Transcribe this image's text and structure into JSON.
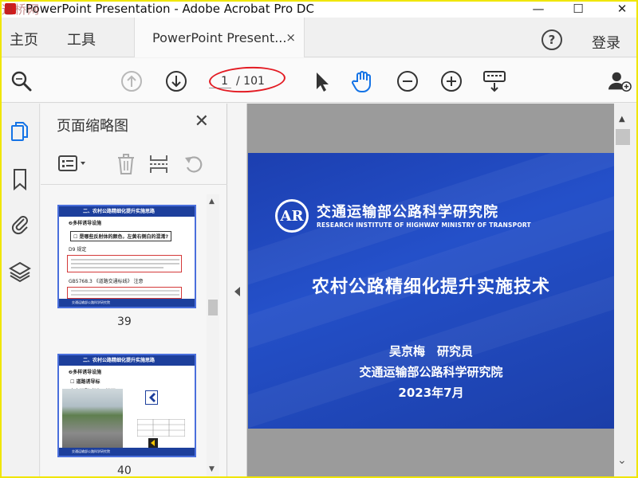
{
  "window": {
    "title": "PowerPoint Presentation - Adobe Acrobat Pro DC",
    "watermark": "道桥网",
    "controls": {
      "minimize": "—",
      "maximize": "☐",
      "close": "✕"
    }
  },
  "menubar": {
    "home_label": "主页",
    "tools_label": "工具",
    "tab_label": "PowerPoint Present...",
    "tab_close": "×",
    "help_glyph": "?",
    "login_label": "登录"
  },
  "toolbar": {
    "icons": [
      "search-icon",
      "prev-page-icon",
      "next-page-icon",
      "select-arrow-icon",
      "hand-tool-icon",
      "zoom-out-icon",
      "zoom-in-icon",
      "keyboard-icon",
      "add-user-icon"
    ],
    "current_page": "1",
    "total_pages": "/ 101",
    "highlight_color": "#e31b23"
  },
  "rail": {
    "icons": [
      "page-thumbnails-icon",
      "bookmark-icon",
      "attachment-icon",
      "layers-icon"
    ],
    "accent": "#1473e6"
  },
  "thumbnails_panel": {
    "title": "页面缩略图",
    "close_glyph": "✕",
    "items": [
      {
        "page_number": "39",
        "header": "二、农村公路精细化提升实施思路",
        "lines": [
          "❷多样诱导设施",
          "☐ 是哪些反射体的颜色，左黄右侧白的混淆?"
        ],
        "sub_lines": [
          "D9 规定",
          "GB5768.3 《道路交通标线》 注意"
        ]
      },
      {
        "page_number": "40",
        "header": "二、农村公路精细化提升实施思路",
        "lines": [
          "❷多样诱导设施",
          "☐ 道路诱导标",
          "存在问题(颜色、间距)"
        ],
        "sub_lines": []
      }
    ]
  },
  "slide": {
    "institute_cn": "交通运输部公路科学研究院",
    "institute_en": "RESEARCH INSTITUTE OF HIGHWAY MINISTRY OF TRANSPORT",
    "logo_text": "AR",
    "title": "农村公路精细化提升实施技术",
    "speaker": "吴京梅　研究员",
    "affiliation": "交通运输部公路科学研究院",
    "date": "2023年7月"
  },
  "colors": {
    "slide_blue": "#1d3f9c",
    "acrobat_red": "#d21c1c",
    "frame_yellow": "#f0e600"
  }
}
